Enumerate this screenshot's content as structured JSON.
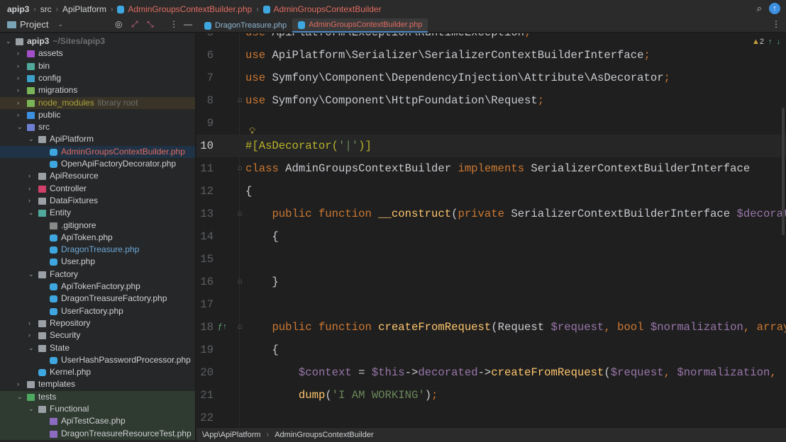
{
  "breadcrumb": [
    "apip3",
    "src",
    "ApiPlatform",
    "AdminGroupsContextBuilder.php",
    "AdminGroupsContextBuilder"
  ],
  "project_label": "Project",
  "tabs": [
    {
      "label": "DragonTreasure.php",
      "active": false
    },
    {
      "label": "AdminGroupsContextBuilder.php",
      "active": true
    }
  ],
  "tree": [
    {
      "d": 0,
      "a": "v",
      "ic": "#9aa0a6",
      "label": "apip3",
      "bold": true,
      "extra": "~/Sites/apip3"
    },
    {
      "d": 1,
      "a": ">",
      "ic": "#a34fc7",
      "label": "assets"
    },
    {
      "d": 1,
      "a": ">",
      "ic": "#4fa89a",
      "label": "bin"
    },
    {
      "d": 1,
      "a": ">",
      "ic": "#3ca0c8",
      "label": "config"
    },
    {
      "d": 1,
      "a": ">",
      "ic": "#7ab458",
      "label": "migrations"
    },
    {
      "d": 1,
      "a": ">",
      "ic": "#7ab458",
      "label": "node_modules",
      "color": "#a9a33a",
      "extra": "library root",
      "bg": "lib"
    },
    {
      "d": 1,
      "a": ">",
      "ic": "#3d8fe0",
      "label": "public"
    },
    {
      "d": 1,
      "a": "v",
      "ic": "#6d7fd0",
      "label": "src"
    },
    {
      "d": 2,
      "a": "v",
      "ic": "#9aa0a6",
      "label": "ApiPlatform"
    },
    {
      "d": 3,
      "a": "",
      "ic": "php",
      "label": "AdminGroupsContextBuilder.php",
      "color": "#e06c60",
      "bg": "sel"
    },
    {
      "d": 3,
      "a": "",
      "ic": "php",
      "label": "OpenApiFactoryDecorator.php"
    },
    {
      "d": 2,
      "a": ">",
      "ic": "#9aa0a6",
      "label": "ApiResource"
    },
    {
      "d": 2,
      "a": ">",
      "ic": "#d0406a",
      "label": "Controller"
    },
    {
      "d": 2,
      "a": ">",
      "ic": "#9aa0a6",
      "label": "DataFixtures"
    },
    {
      "d": 2,
      "a": "v",
      "ic": "#4fa89a",
      "label": "Entity"
    },
    {
      "d": 3,
      "a": "",
      "ic": "#888",
      "label": ".gitignore"
    },
    {
      "d": 3,
      "a": "",
      "ic": "php",
      "label": "ApiToken.php"
    },
    {
      "d": 3,
      "a": "",
      "ic": "php",
      "label": "DragonTreasure.php",
      "color": "#6ea8d8"
    },
    {
      "d": 3,
      "a": "",
      "ic": "php",
      "label": "User.php"
    },
    {
      "d": 2,
      "a": "v",
      "ic": "#9aa0a6",
      "label": "Factory"
    },
    {
      "d": 3,
      "a": "",
      "ic": "php",
      "label": "ApiTokenFactory.php"
    },
    {
      "d": 3,
      "a": "",
      "ic": "php",
      "label": "DragonTreasureFactory.php"
    },
    {
      "d": 3,
      "a": "",
      "ic": "php",
      "label": "UserFactory.php"
    },
    {
      "d": 2,
      "a": ">",
      "ic": "#9aa0a6",
      "label": "Repository"
    },
    {
      "d": 2,
      "a": ">",
      "ic": "#9aa0a6",
      "label": "Security"
    },
    {
      "d": 2,
      "a": "v",
      "ic": "#9aa0a6",
      "label": "State"
    },
    {
      "d": 3,
      "a": "",
      "ic": "php",
      "label": "UserHashPasswordProcessor.php"
    },
    {
      "d": 2,
      "a": "",
      "ic": "php",
      "label": "Kernel.php"
    },
    {
      "d": 1,
      "a": ">",
      "ic": "#9aa0a6",
      "label": "templates"
    },
    {
      "d": 1,
      "a": "v",
      "ic": "#4fa860",
      "label": "tests",
      "bg": "test"
    },
    {
      "d": 2,
      "a": "v",
      "ic": "#9aa0a6",
      "label": "Functional",
      "bg": "test"
    },
    {
      "d": 3,
      "a": "",
      "ic": "#8c6cc0",
      "label": "ApiTestCase.php",
      "bg": "test"
    },
    {
      "d": 3,
      "a": "",
      "ic": "#8c6cc0",
      "label": "DragonTreasureResourceTest.php",
      "bg": "test"
    }
  ],
  "editor": {
    "warnings": "2",
    "lines": [
      {
        "n": "5",
        "t": [
          [
            "kw",
            "use "
          ],
          [
            "ns",
            "ApiPlatform\\Exception\\RuntimeException"
          ],
          [
            "pn",
            ";"
          ]
        ]
      },
      {
        "n": "6",
        "t": [
          [
            "kw",
            "use "
          ],
          [
            "ns",
            "ApiPlatform\\Serializer\\SerializerContextBuilderInterface"
          ],
          [
            "pn",
            ";"
          ]
        ]
      },
      {
        "n": "7",
        "t": [
          [
            "kw",
            "use "
          ],
          [
            "ns",
            "Symfony\\Component\\DependencyInjection\\Attribute\\AsDecorator"
          ],
          [
            "pn",
            ";"
          ]
        ]
      },
      {
        "n": "8",
        "t": [
          [
            "kw",
            "use "
          ],
          [
            "ns",
            "Symfony\\Component\\HttpFoundation\\Request"
          ],
          [
            "pn",
            ";"
          ]
        ]
      },
      {
        "n": "9",
        "t": []
      },
      {
        "n": "10",
        "t": [
          [
            "at",
            "#[AsDecorator("
          ],
          [
            "str",
            "'|'"
          ],
          [
            "at",
            ")]"
          ]
        ]
      },
      {
        "n": "11",
        "t": [
          [
            "kw",
            "class "
          ],
          [
            "pl",
            "AdminGroupsContextBuilder "
          ],
          [
            "kw",
            "implements "
          ],
          [
            "pl",
            "SerializerContextBuilderInterface"
          ]
        ]
      },
      {
        "n": "12",
        "t": [
          [
            "pl",
            "{"
          ]
        ]
      },
      {
        "n": "13",
        "t": [
          [
            "pl",
            "    "
          ],
          [
            "kw",
            "public function "
          ],
          [
            "fn",
            "__construct"
          ],
          [
            "pl",
            "("
          ],
          [
            "kw",
            "private "
          ],
          [
            "pl",
            "SerializerContextBuilderInterface "
          ],
          [
            "var",
            "$decorated"
          ]
        ]
      },
      {
        "n": "14",
        "t": [
          [
            "pl",
            "    {"
          ]
        ]
      },
      {
        "n": "15",
        "t": []
      },
      {
        "n": "16",
        "t": [
          [
            "pl",
            "    }"
          ]
        ]
      },
      {
        "n": "17",
        "t": []
      },
      {
        "n": "18",
        "t": [
          [
            "pl",
            "    "
          ],
          [
            "kw",
            "public function "
          ],
          [
            "fn",
            "createFromRequest"
          ],
          [
            "pl",
            "(Request "
          ],
          [
            "var",
            "$request"
          ],
          [
            "pn",
            ", "
          ],
          [
            "kw",
            "bool "
          ],
          [
            "var",
            "$normalization"
          ],
          [
            "pn",
            ", "
          ],
          [
            "kw",
            "array"
          ]
        ]
      },
      {
        "n": "19",
        "t": [
          [
            "pl",
            "    {"
          ]
        ]
      },
      {
        "n": "20",
        "t": [
          [
            "pl",
            "        "
          ],
          [
            "var",
            "$context"
          ],
          [
            "pl",
            " = "
          ],
          [
            "var",
            "$this"
          ],
          [
            "pl",
            "->"
          ],
          [
            "var",
            "decorated"
          ],
          [
            "pl",
            "->"
          ],
          [
            "fn",
            "createFromRequest"
          ],
          [
            "pl",
            "("
          ],
          [
            "var",
            "$request"
          ],
          [
            "pn",
            ", "
          ],
          [
            "var",
            "$normalization"
          ],
          [
            "pn",
            ","
          ]
        ]
      },
      {
        "n": "21",
        "t": [
          [
            "pl",
            "        "
          ],
          [
            "fn",
            "dump"
          ],
          [
            "pl",
            "("
          ],
          [
            "str",
            "'I AM WORKING'"
          ],
          [
            "pl",
            ")"
          ],
          [
            "pn",
            ";"
          ]
        ]
      },
      {
        "n": "22",
        "t": []
      }
    ]
  },
  "status": [
    "\\App\\ApiPlatform",
    "AdminGroupsContextBuilder"
  ]
}
